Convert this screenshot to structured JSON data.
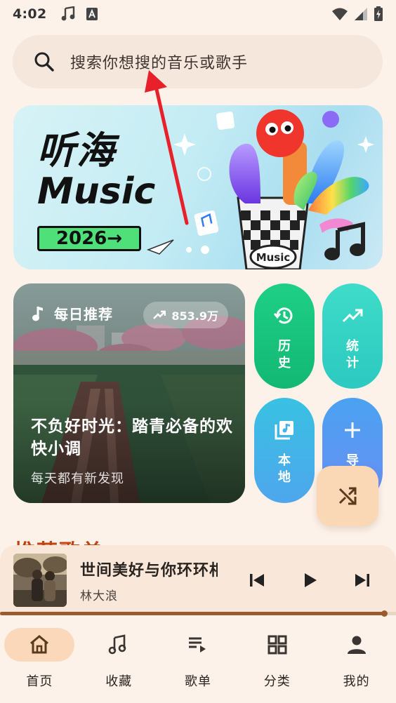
{
  "status_bar": {
    "time": "4:02"
  },
  "search": {
    "placeholder": "搜索你想搜的音乐或歌手"
  },
  "banner": {
    "title_line1": "听海",
    "title_line2": "Music",
    "year_badge": "2026→",
    "cup_label": "Music"
  },
  "daily": {
    "label": "每日推荐",
    "play_count": "853.9万",
    "title": "不负好时光：踏青必备的欢快小调",
    "subtitle": "每天都有新发现"
  },
  "tiles": {
    "history": "历史",
    "stats": "统计",
    "local": "本地",
    "import": "导"
  },
  "section": {
    "heading": "推荐歌单"
  },
  "now_playing": {
    "title": "世间美好与你环环相扣",
    "artist": "林大浪",
    "progress": 0.97
  },
  "nav": [
    {
      "label": "首页",
      "icon": "home-icon",
      "active": true
    },
    {
      "label": "收藏",
      "icon": "music-note-icon",
      "active": false
    },
    {
      "label": "歌单",
      "icon": "playlist-icon",
      "active": false
    },
    {
      "label": "分类",
      "icon": "grid-icon",
      "active": false
    },
    {
      "label": "我的",
      "icon": "person-icon",
      "active": false
    }
  ],
  "colors": {
    "accent": "#fbd8ba",
    "history_tile": "#12b874",
    "stats_tile": "#2bc9c0",
    "local_tile": "#4ea6ec",
    "progress": "#9a5c2e",
    "annotation": "#e8202a"
  }
}
